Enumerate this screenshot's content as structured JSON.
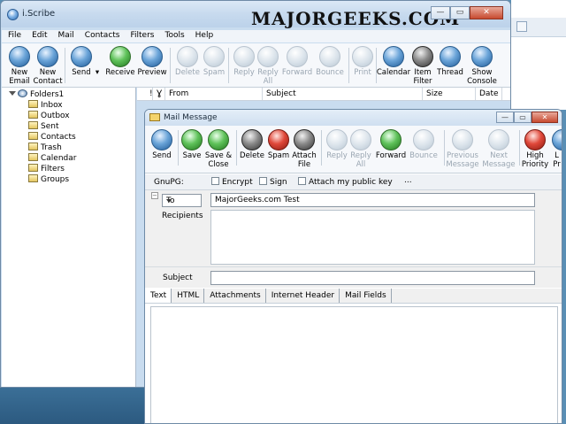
{
  "main_window": {
    "title": "i.Scribe",
    "watermark": "MAJORGEEKS.COM",
    "caption": {
      "minimize": "—",
      "maximize": "▭",
      "close": "✕"
    },
    "menu": [
      "File",
      "Edit",
      "Mail",
      "Contacts",
      "Filters",
      "Tools",
      "Help"
    ],
    "toolbar": [
      {
        "l1": "New",
        "l2": "Email",
        "state": "enabled",
        "icon": "new-email-icon"
      },
      {
        "l1": "New",
        "l2": "Contact",
        "state": "enabled",
        "icon": "new-contact-icon"
      },
      {
        "l1": "Send",
        "l2": "",
        "state": "enabled",
        "icon": "send-icon"
      },
      {
        "l1": "Receive",
        "l2": "",
        "state": "enabled",
        "icon": "receive-icon"
      },
      {
        "l1": "Preview",
        "l2": "",
        "state": "enabled",
        "icon": "preview-icon"
      },
      {
        "l1": "Delete",
        "l2": "",
        "state": "disabled",
        "icon": "delete-icon"
      },
      {
        "l1": "Spam",
        "l2": "",
        "state": "disabled",
        "icon": "spam-icon"
      },
      {
        "l1": "Reply",
        "l2": "",
        "state": "disabled",
        "icon": "reply-icon"
      },
      {
        "l1": "Reply",
        "l2": "All",
        "state": "disabled",
        "icon": "reply-all-icon"
      },
      {
        "l1": "Forward",
        "l2": "",
        "state": "disabled",
        "icon": "forward-icon"
      },
      {
        "l1": "Bounce",
        "l2": "",
        "state": "disabled",
        "icon": "bounce-icon"
      },
      {
        "l1": "Print",
        "l2": "",
        "state": "disabled",
        "icon": "print-icon"
      },
      {
        "l1": "Calendar",
        "l2": "",
        "state": "enabled",
        "icon": "calendar-icon"
      },
      {
        "l1": "Item",
        "l2": "Filter",
        "state": "enabled",
        "icon": "item-filter-icon"
      },
      {
        "l1": "Thread",
        "l2": "",
        "state": "enabled",
        "icon": "thread-icon"
      },
      {
        "l1": "Show",
        "l2": "Console",
        "state": "enabled",
        "icon": "show-console-icon"
      }
    ],
    "send_dropdown": "▾",
    "folders": {
      "root": "Folders1",
      "items": [
        "Inbox",
        "Outbox",
        "Sent",
        "Contacts",
        "Trash",
        "Calendar",
        "Filters",
        "Groups"
      ]
    },
    "list_columns": [
      "!",
      "Ɣ",
      "From",
      "Subject",
      "Size",
      "Date"
    ]
  },
  "mail_window": {
    "title": "Mail Message",
    "caption": {
      "minimize": "—",
      "maximize": "▭",
      "close": "✕"
    },
    "toolbar": [
      {
        "l1": "Send",
        "l2": "",
        "state": "enabled",
        "icon": "send-icon",
        "tone": "blue"
      },
      {
        "l1": "Save",
        "l2": "",
        "state": "enabled",
        "icon": "save-icon",
        "tone": "green"
      },
      {
        "l1": "Save &",
        "l2": "Close",
        "state": "enabled",
        "icon": "save-close-icon",
        "tone": "green"
      },
      {
        "l1": "Delete",
        "l2": "",
        "state": "enabled",
        "icon": "delete-icon",
        "tone": "dark"
      },
      {
        "l1": "Spam",
        "l2": "",
        "state": "enabled",
        "icon": "spam-icon",
        "tone": "red"
      },
      {
        "l1": "Attach",
        "l2": "File",
        "state": "enabled",
        "icon": "attach-file-icon",
        "tone": "blue"
      },
      {
        "l1": "Reply",
        "l2": "",
        "state": "disabled",
        "icon": "reply-icon",
        "tone": "grey"
      },
      {
        "l1": "Reply",
        "l2": "All",
        "state": "disabled",
        "icon": "reply-all-icon",
        "tone": "grey"
      },
      {
        "l1": "Forward",
        "l2": "",
        "state": "enabled",
        "icon": "forward-icon",
        "tone": "green"
      },
      {
        "l1": "Bounce",
        "l2": "",
        "state": "disabled",
        "icon": "bounce-icon",
        "tone": "grey"
      },
      {
        "l1": "Previous",
        "l2": "Message",
        "state": "disabled",
        "icon": "previous-message-icon",
        "tone": "grey"
      },
      {
        "l1": "Next",
        "l2": "Message",
        "state": "disabled",
        "icon": "next-message-icon",
        "tone": "grey"
      },
      {
        "l1": "High",
        "l2": "Priority",
        "state": "enabled",
        "icon": "high-priority-icon",
        "tone": "red"
      },
      {
        "l1": "L",
        "l2": "Pr",
        "state": "enabled",
        "icon": "low-priority-icon",
        "tone": "blue"
      }
    ],
    "gnupg": {
      "label": "GnuPG:",
      "encrypt": "Encrypt",
      "sign": "Sign",
      "attach_key": "Attach my public key",
      "more": "..."
    },
    "to_type": "To",
    "to_value": "MajorGeeks.com Test",
    "recipients_label": "Recipients",
    "subject_label": "Subject",
    "subject_value": "",
    "tabs": [
      "Text",
      "HTML",
      "Attachments",
      "Internet Header",
      "Mail Fields"
    ],
    "expander_symbol": "−"
  }
}
